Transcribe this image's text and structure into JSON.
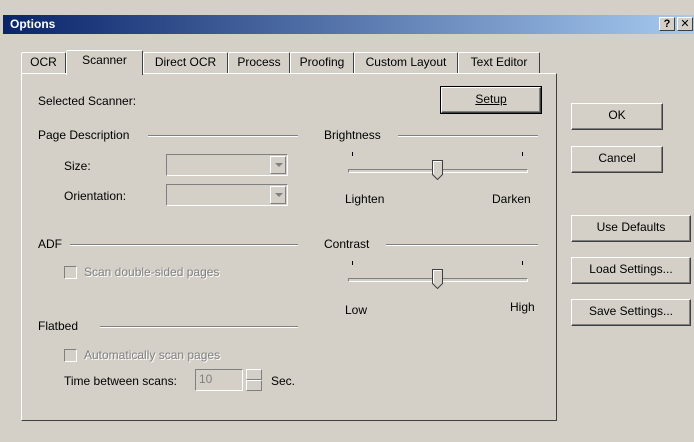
{
  "window": {
    "title": "Options",
    "help_button": "?",
    "close_button": "✕"
  },
  "tabs": [
    {
      "label": "OCR"
    },
    {
      "label": "Scanner",
      "active": true
    },
    {
      "label": "Direct OCR"
    },
    {
      "label": "Process"
    },
    {
      "label": "Proofing"
    },
    {
      "label": "Custom Layout"
    },
    {
      "label": "Text Editor"
    }
  ],
  "scanner": {
    "selected_scanner_label": "Selected Scanner:",
    "setup_button": "Setup",
    "page_description": {
      "header": "Page Description",
      "size_label": "Size:",
      "size_value": "",
      "orientation_label": "Orientation:",
      "orientation_value": ""
    },
    "adf": {
      "header": "ADF",
      "scan_double_sided_label": "Scan double-sided pages",
      "scan_double_sided_checked": false
    },
    "flatbed": {
      "header": "Flatbed",
      "auto_scan_label": "Automatically scan pages",
      "auto_scan_checked": false,
      "time_between_label": "Time between scans:",
      "time_between_value": "10",
      "time_unit": "Sec."
    },
    "brightness": {
      "header": "Brightness",
      "min_label": "Lighten",
      "max_label": "Darken",
      "level": 0.5
    },
    "contrast": {
      "header": "Contrast",
      "min_label": "Low",
      "max_label": "High",
      "level": 0.5
    }
  },
  "side_buttons": {
    "ok": "OK",
    "cancel": "Cancel",
    "use_defaults": "Use Defaults",
    "load_settings": "Load Settings...",
    "save_settings": "Save Settings..."
  },
  "colors": {
    "face": "#d4d0c8",
    "title_start": "#0a246a",
    "title_end": "#a6caf0"
  }
}
